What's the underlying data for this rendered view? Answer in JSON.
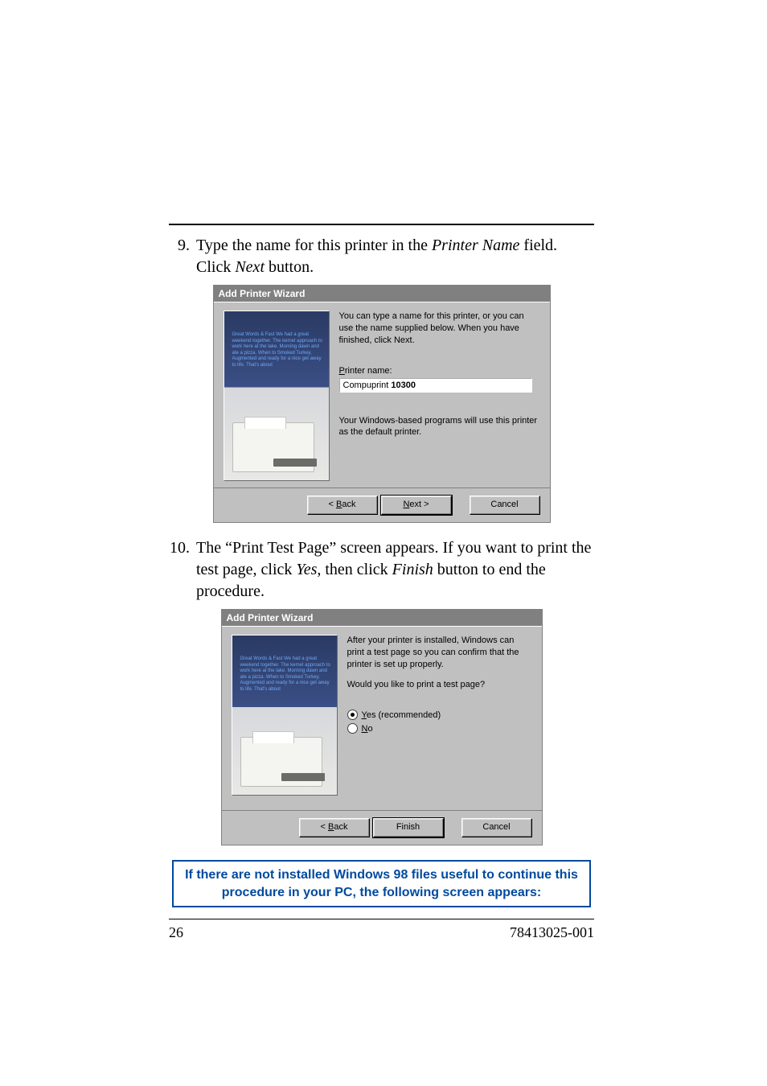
{
  "list": {
    "item9": {
      "num": "9.",
      "text_before": "Type the name for this printer in the ",
      "em1": "Printer Name",
      "text_mid": " field. Click ",
      "em2": "Next",
      "text_after": " button."
    },
    "item10": {
      "num": "10.",
      "text_before": "The “Print  Test Page” screen appears. If you want to print the test page, click ",
      "em1": "Yes",
      "text_mid": ", then click ",
      "em2": "Finish",
      "text_after": " button to end the procedure."
    }
  },
  "wizard1": {
    "title": "Add Printer Wizard",
    "para": "You can type a name for this printer, or you can use the name supplied below. When you have finished, click Next.",
    "label_pre": "P",
    "label_post": "rinter name:",
    "input_pre": "Compuprint ",
    "input_bold": "10300",
    "default_msg": "Your Windows-based programs will use this printer as the default printer.",
    "back_lt": "< ",
    "back_u": "B",
    "back_post": "ack",
    "next_pre": "N",
    "next_post": "ext >",
    "cancel": "Cancel"
  },
  "wizard2": {
    "title": "Add Printer Wizard",
    "para1": "After your printer is installed, Windows can print a test page so you can confirm that the printer is set up properly.",
    "para2": "Would you like to print a test page?",
    "yes_u": "Y",
    "yes_post": "es (recommended)",
    "no_u": "N",
    "no_post": "o",
    "back_lt": "< ",
    "back_u": "B",
    "back_post": "ack",
    "finish": "Finish",
    "cancel": "Cancel"
  },
  "note": "If there are not installed Windows 98 files useful to continue this procedure in your PC, the following screen appears:",
  "footer": {
    "page": "26",
    "doc": "78413025-001"
  },
  "ill_blob": "Great Words & Fast\nWe had a great weekend together. The kernel approach to work here at the lake. Morning dawn and ate a pizza. When to Smoked Turkey, Augmented and ready for a nice get away to life. That's about"
}
